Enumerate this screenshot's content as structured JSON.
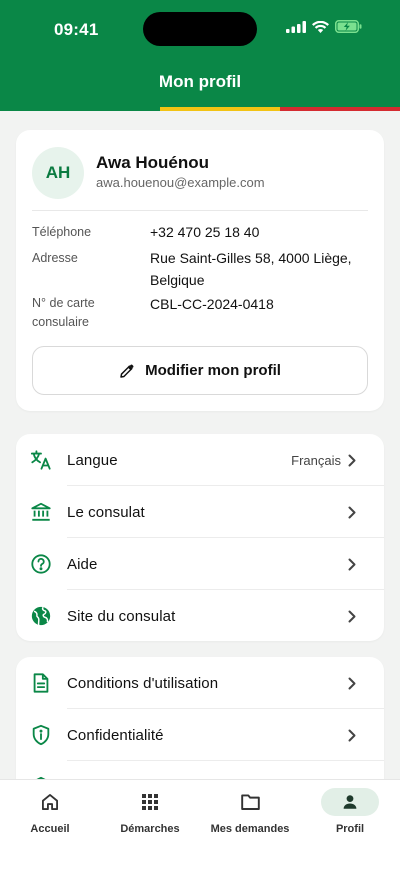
{
  "status_bar": {
    "time": "09:41"
  },
  "header": {
    "title": "Mon profil"
  },
  "colors": {
    "primary": "#0a8747",
    "flag_yellow": "#f2c314",
    "flag_red": "#d42b30"
  },
  "profile": {
    "initials": "AH",
    "name": "Awa Houénou",
    "email": "awa.houenou@example.com",
    "phone_label": "Téléphone",
    "phone": "+32 470 25 18 40",
    "address_label": "Adresse",
    "address_line1": "Rue Saint-Gilles 58, 4000 Liège,",
    "address_line2": "Belgique",
    "card_label_line1": "N° de carte",
    "card_label_line2": "consulaire",
    "card_number": "CBL-CC-2024-0418",
    "edit_button": "Modifier mon profil"
  },
  "menu": [
    {
      "icon": "translate-icon",
      "label": "Langue",
      "value": "Français"
    },
    {
      "icon": "bank-icon",
      "label": "Le consulat"
    },
    {
      "icon": "help-circle-icon",
      "label": "Aide"
    },
    {
      "icon": "globe-icon",
      "label": "Site du consulat"
    }
  ],
  "legal": [
    {
      "icon": "document-icon",
      "label": "Conditions d'utilisation"
    },
    {
      "icon": "shield-info-icon",
      "label": "Confidentialité"
    }
  ],
  "tabs": [
    {
      "icon": "home-icon",
      "label": "Accueil"
    },
    {
      "icon": "grid-icon",
      "label": "Démarches"
    },
    {
      "icon": "folder-icon",
      "label": "Mes demandes"
    },
    {
      "icon": "person-icon",
      "label": "Profil",
      "active": true
    }
  ]
}
